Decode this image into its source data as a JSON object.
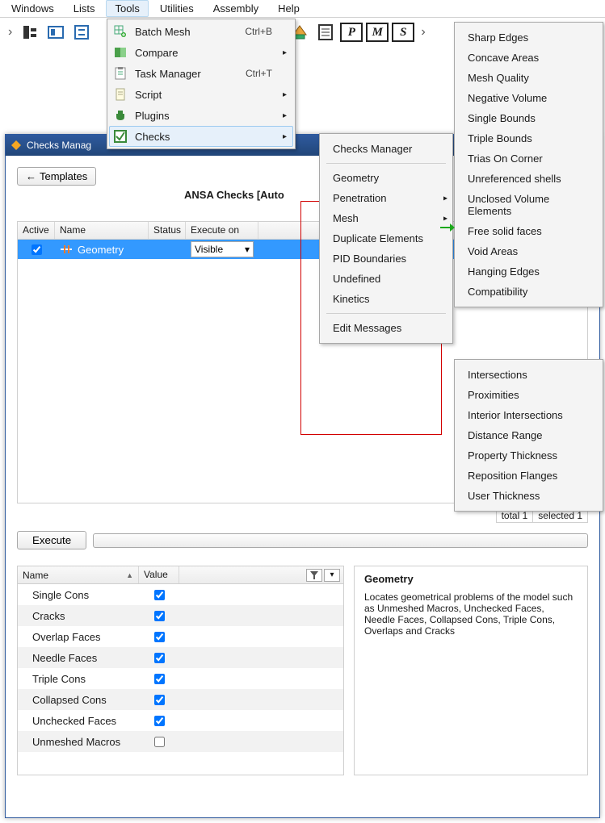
{
  "menubar": [
    "Windows",
    "Lists",
    "Tools",
    "Utilities",
    "Assembly",
    "Help"
  ],
  "active_menu_index": 2,
  "tools_menu": [
    {
      "label": "Batch Mesh",
      "shortcut": "Ctrl+B",
      "icon": "grid-plus",
      "sub": false
    },
    {
      "label": "Compare",
      "shortcut": "",
      "icon": "compare",
      "sub": true
    },
    {
      "label": "Task Manager",
      "shortcut": "Ctrl+T",
      "icon": "task",
      "sub": false
    },
    {
      "label": "Script",
      "shortcut": "",
      "icon": "scroll",
      "sub": true
    },
    {
      "label": "Plugins",
      "shortcut": "",
      "icon": "plug",
      "sub": true
    },
    {
      "label": "Checks",
      "shortcut": "",
      "icon": "check",
      "sub": true
    }
  ],
  "checks_submenu": {
    "group1": [
      "Checks Manager"
    ],
    "group2": [
      "Geometry",
      "Penetration",
      "Mesh",
      "Duplicate Elements",
      "PID Boundaries",
      "Undefined",
      "Kinetics"
    ],
    "group3": [
      "Edit Messages"
    ],
    "subflags": {
      "Penetration": true,
      "Mesh": true
    }
  },
  "mesh_submenu": [
    "Sharp Edges",
    "Concave Areas",
    "Mesh Quality",
    "Negative Volume",
    "Single Bounds",
    "Triple Bounds",
    "Trias On Corner",
    "Unreferenced shells",
    "Unclosed Volume Elements",
    "Free solid faces",
    "Void Areas",
    "Hanging Edges",
    "Compatibility"
  ],
  "extra_submenu": [
    "Intersections",
    "Proximities",
    "Interior Intersections",
    "Distance Range",
    "Property Thickness",
    "Reposition Flanges",
    "User Thickness"
  ],
  "window": {
    "title": "Checks Manag",
    "templates_btn": "Templates",
    "heading": "ANSA Checks [Auto",
    "columns": {
      "active": "Active",
      "name": "Name",
      "status": "Status",
      "exec": "Execute on"
    },
    "row": {
      "name": "Geometry",
      "exec": "Visible"
    },
    "status_total": "total 1",
    "status_selected": "selected 1",
    "execute_btn": "Execute",
    "props_header": {
      "name": "Name",
      "value": "Value"
    },
    "props": [
      {
        "name": "Single Cons",
        "checked": true
      },
      {
        "name": "Cracks",
        "checked": true
      },
      {
        "name": "Overlap Faces",
        "checked": true
      },
      {
        "name": "Needle Faces",
        "checked": true
      },
      {
        "name": "Triple Cons",
        "checked": true
      },
      {
        "name": "Collapsed Cons",
        "checked": true
      },
      {
        "name": "Unchecked Faces",
        "checked": true
      },
      {
        "name": "Unmeshed Macros",
        "checked": false
      }
    ],
    "desc_title": "Geometry",
    "desc_body": "Locates geometrical problems of the model such as Unmeshed Macros, Unchecked Faces, Needle Faces, Collapsed Cons, Triple Cons, Overlaps and Cracks"
  }
}
